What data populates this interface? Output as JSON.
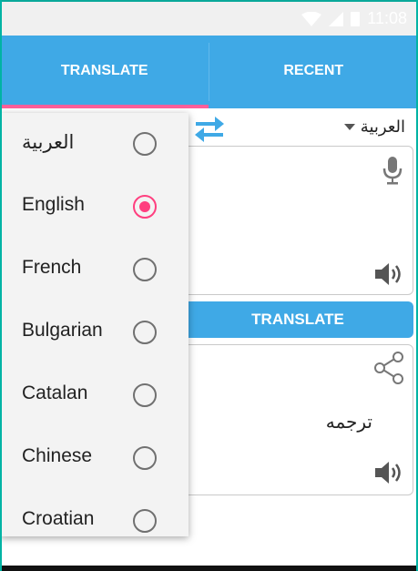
{
  "status_bar": {
    "time": "11:08"
  },
  "tabs": [
    {
      "label": "TRANSLATE",
      "selected": true
    },
    {
      "label": "RECENT",
      "selected": false
    }
  ],
  "source_language": "العربية",
  "translate_button": "TRANSLATE",
  "output_text": "ترجمه",
  "languages": [
    {
      "label": "العربية",
      "selected": false
    },
    {
      "label": "English",
      "selected": true
    },
    {
      "label": "French",
      "selected": false
    },
    {
      "label": "Bulgarian",
      "selected": false
    },
    {
      "label": "Catalan",
      "selected": false
    },
    {
      "label": "Chinese",
      "selected": false
    },
    {
      "label": "Croatian",
      "selected": false
    }
  ],
  "colors": {
    "primary": "#3fa9e6",
    "accent": "#ff3f7f",
    "tab_indicator": "#ff5f9a"
  },
  "icons": [
    "wifi-icon",
    "signal-icon",
    "battery-icon",
    "swap-icon",
    "mic-icon",
    "speaker-icon",
    "share-icon"
  ]
}
